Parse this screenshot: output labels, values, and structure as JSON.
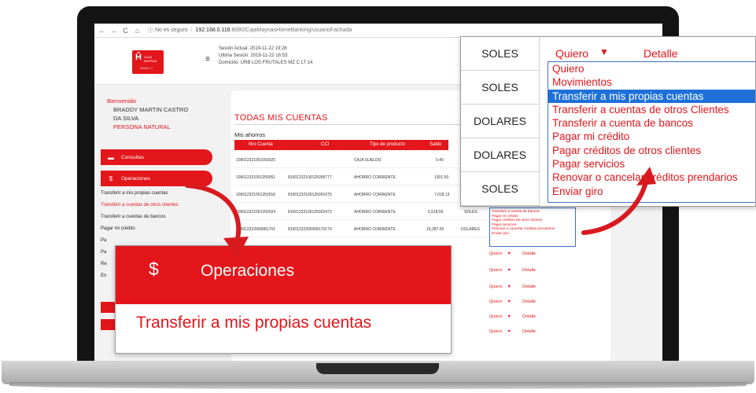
{
  "browser": {
    "back": "←",
    "forward": "→",
    "reload": "C",
    "home": "⌂",
    "security": "No es seguro",
    "host": "192.168.0.116",
    "path": ":8080/CajaMaynasHomeBanking/usuarioFachada"
  },
  "header": {
    "logo_text": "CAJA MAYNAS",
    "logo_sub": "Desde 1°",
    "session_current": "Sesión Actual: 2019-11-22 19:28",
    "session_last": "Ultima Sesión: 2019-11-22 16:53",
    "address": "Domicilio: URB LOS FRUTALES MZ C LT 14"
  },
  "sidebar": {
    "welcome": "Bienvenido",
    "name_line1": "BRADDY MARTIN CASTRO",
    "name_line2": "DA SILVA",
    "person_type": "PERSONA NATURAL",
    "consultas": "Consultas",
    "operaciones": "Operaciones",
    "submenu": [
      "Transferir a mis propias cuentas",
      "Transferir a cuentas de otros clientes",
      "Transferir a cuentas de bancos",
      "Pagar mi crédito",
      "Pa",
      "Pa",
      "Re",
      "En"
    ]
  },
  "panel": {
    "title": "TODAS MIS CUENTAS",
    "subtitle": "Mis ahorros",
    "columns": [
      "Nro Cuenta",
      "CCI",
      "Tipo de producto",
      "Saldo"
    ],
    "rows": [
      {
        "account": "109012321001093025",
        "cci": "",
        "type": "CAJA SUELDO",
        "balance": "0.40",
        "currency": ""
      },
      {
        "account": "109012321001250051",
        "cci": "81001232100125005777",
        "type": "AHORRO CORRIENTE",
        "balance": "1301.59",
        "currency": ""
      },
      {
        "account": "109012321001250016",
        "cci": "81001232100125001675",
        "type": "AHORRO CORRIENTE",
        "balance": "7,018.13",
        "currency": ""
      },
      {
        "account": "109012321001250024",
        "cci": "81001232100125002473",
        "type": "AHORRO CORRIENTE",
        "balance": "5,518.55",
        "currency": "SOLES"
      },
      {
        "account": "109012322000081701",
        "cci": "81001232200008170179",
        "type": "AHORRO CORRIENTE",
        "balance": "16,287.05",
        "currency": "DOLARES"
      }
    ],
    "mini_menu": [
      "Transferir a cuenta de bancos",
      "Pagar mi crédito",
      "Pagar créditos de otros clientes",
      "Pagar servicios",
      "Renovar o cancelar créditos prendarios",
      "Enviar giro"
    ],
    "quiero": "Quiero",
    "quiero_arrow": "▼",
    "detalle": "Detalle"
  },
  "zoom_operaciones": {
    "icon": "$",
    "label": "Operaciones",
    "item": "Transferir a mis propias cuentas"
  },
  "zoom_dropdown": {
    "currencies": [
      "SOLES",
      "SOLES",
      "DOLARES",
      "DOLARES",
      "SOLES"
    ],
    "selected": "Quiero",
    "arrow": "▼",
    "detail": "Detalle",
    "options": [
      "Quiero",
      "Movimientos",
      "Transferir a mis propias cuentas",
      "Transferir a cuentas de otros Clientes",
      "Transferir a cuenta de bancos",
      "Pagar mi crédito",
      "Pagar créditos de otros clientes",
      "Pagar servicios",
      "Renovar o cancelar créditos prendarios",
      "Enviar giro"
    ],
    "highlighted_index": 2
  },
  "colors": {
    "brand_red": "#e3161b",
    "selection_blue": "#1e70d8"
  }
}
